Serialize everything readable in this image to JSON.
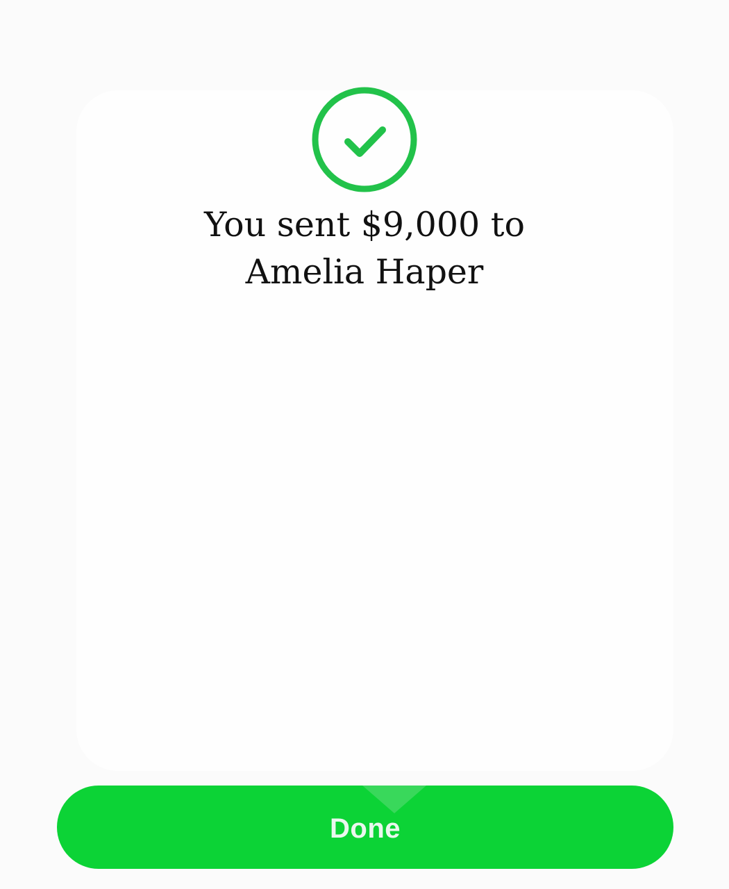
{
  "confirmation": {
    "icon": "check-circle-icon",
    "line1": "You sent $9,000 to",
    "line2": "Amelia Haper"
  },
  "actions": {
    "done_label": "Done"
  },
  "colors": {
    "accent": "#0cd336",
    "icon_green": "#22c24a",
    "text": "#111111",
    "background": "#fbfbfb"
  }
}
